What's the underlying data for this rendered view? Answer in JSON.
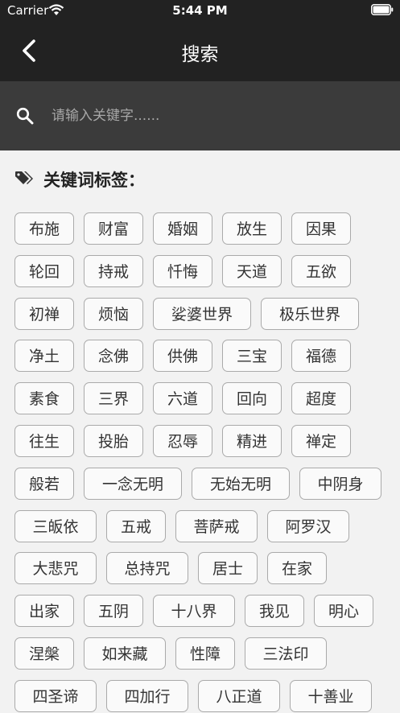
{
  "status": {
    "carrier": "Carrier",
    "time": "5:44 PM"
  },
  "nav": {
    "title": "搜索"
  },
  "search": {
    "placeholder": "请输入关键字......"
  },
  "section": {
    "title": "关键词标签："
  },
  "tag_rows": [
    [
      "布施",
      "财富",
      "婚姻",
      "放生",
      "因果"
    ],
    [
      "轮回",
      "持戒",
      "忏悔",
      "天道",
      "五欲"
    ],
    [
      "初禅",
      "烦恼",
      "娑婆世界",
      "极乐世界"
    ],
    [
      "净土",
      "念佛",
      "供佛",
      "三宝",
      "福德"
    ],
    [
      "素食",
      "三界",
      "六道",
      "回向",
      "超度"
    ],
    [
      "往生",
      "投胎",
      "忍辱",
      "精进",
      "禅定"
    ],
    [
      "般若",
      "一念无明",
      "无始无明",
      "中阴身"
    ],
    [
      "三皈依",
      "五戒",
      "菩萨戒",
      "阿罗汉"
    ],
    [
      "大悲咒",
      "总持咒",
      "居士",
      "在家"
    ],
    [
      "出家",
      "五阴",
      "十八界",
      "我见",
      "明心"
    ],
    [
      "涅槃",
      "如来藏",
      "性障",
      "三法印"
    ],
    [
      "四圣谛",
      "四加行",
      "八正道",
      "十善业"
    ]
  ]
}
